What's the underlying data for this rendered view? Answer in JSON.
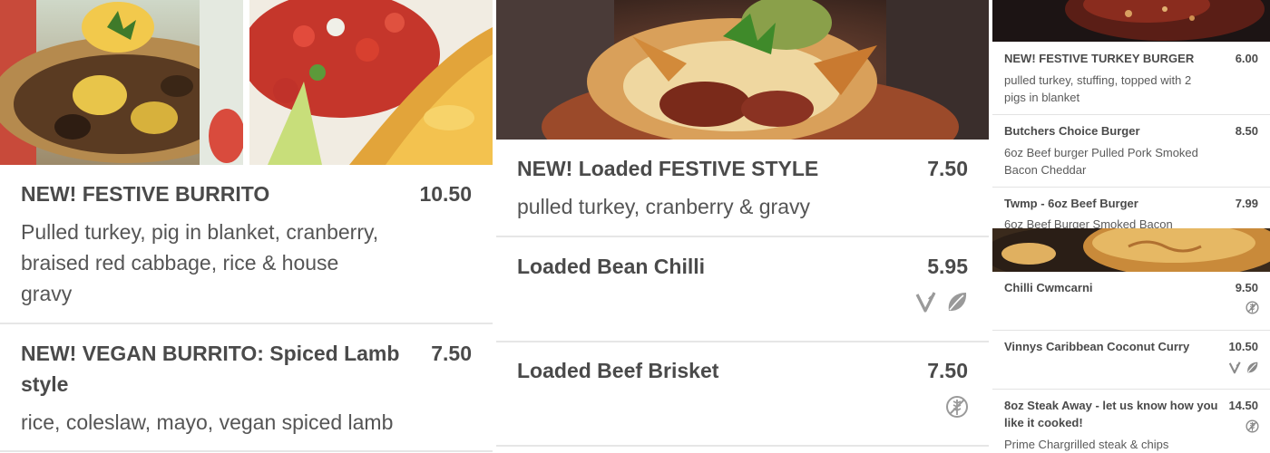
{
  "colors": {
    "text_title": "#4a4a4a",
    "text_desc": "#555555",
    "divider": "#e6e6e6",
    "icon_gray": "#9a9a9a"
  },
  "panels": [
    {
      "photos": [
        "burrito-cross-section-photo",
        "burrito-salsa-photo"
      ],
      "items": [
        {
          "title": "NEW! FESTIVE BURRITO",
          "price": "10.50",
          "desc_lines": [
            "Pulled turkey, pig in blanket, cranberry,",
            "braised red cabbage, rice & house",
            "gravy"
          ],
          "icons": []
        },
        {
          "title_lines": [
            "NEW! VEGAN BURRITO: Spiced Lamb",
            "style"
          ],
          "price": "7.50",
          "desc_lines": [
            "rice, coleslaw, mayo, vegan spiced lamb"
          ],
          "icons": []
        }
      ]
    },
    {
      "photos": [
        "loaded-nachos-photo"
      ],
      "items": [
        {
          "title": "NEW! Loaded FESTIVE STYLE",
          "price": "7.50",
          "desc": "pulled turkey, cranberry & gravy",
          "icons": []
        },
        {
          "title": "Loaded Bean Chilli",
          "price": "5.95",
          "icons": [
            "vegan-icon",
            "vegetarian-leaf-icon"
          ]
        },
        {
          "title": "Loaded Beef Brisket",
          "price": "7.50",
          "icons": [
            "gluten-free-icon"
          ]
        }
      ]
    },
    {
      "photos": [
        "ribs-photo",
        "pie-photo"
      ],
      "items": [
        {
          "title": "NEW! FESTIVE TURKEY BURGER",
          "price": "6.00",
          "desc_lines": [
            "pulled turkey, stuffing, topped with 2",
            "pigs in blanket"
          ]
        },
        {
          "title": "Butchers Choice Burger",
          "price": "8.50",
          "desc_lines": [
            "6oz Beef burger Pulled Pork Smoked",
            "Bacon Cheddar"
          ]
        },
        {
          "title": "Twmp - 6oz Beef Burger",
          "price": "7.99",
          "desc_lines": [
            "6oz Beef Burger Smoked Bacon"
          ]
        },
        {
          "title": "Chilli Cwmcarni",
          "price": "9.50",
          "icons": [
            "gluten-free-icon"
          ]
        },
        {
          "title": "Vinnys Caribbean Coconut Curry",
          "price": "10.50",
          "icons": [
            "vegan-icon",
            "vegetarian-leaf-icon"
          ]
        },
        {
          "title_lines": [
            "8oz Steak Away - let us know how you",
            "like it cooked!"
          ],
          "price": "14.50",
          "desc_lines": [
            "Prime Chargrilled steak & chips"
          ],
          "icons": [
            "gluten-free-icon"
          ]
        }
      ]
    }
  ]
}
